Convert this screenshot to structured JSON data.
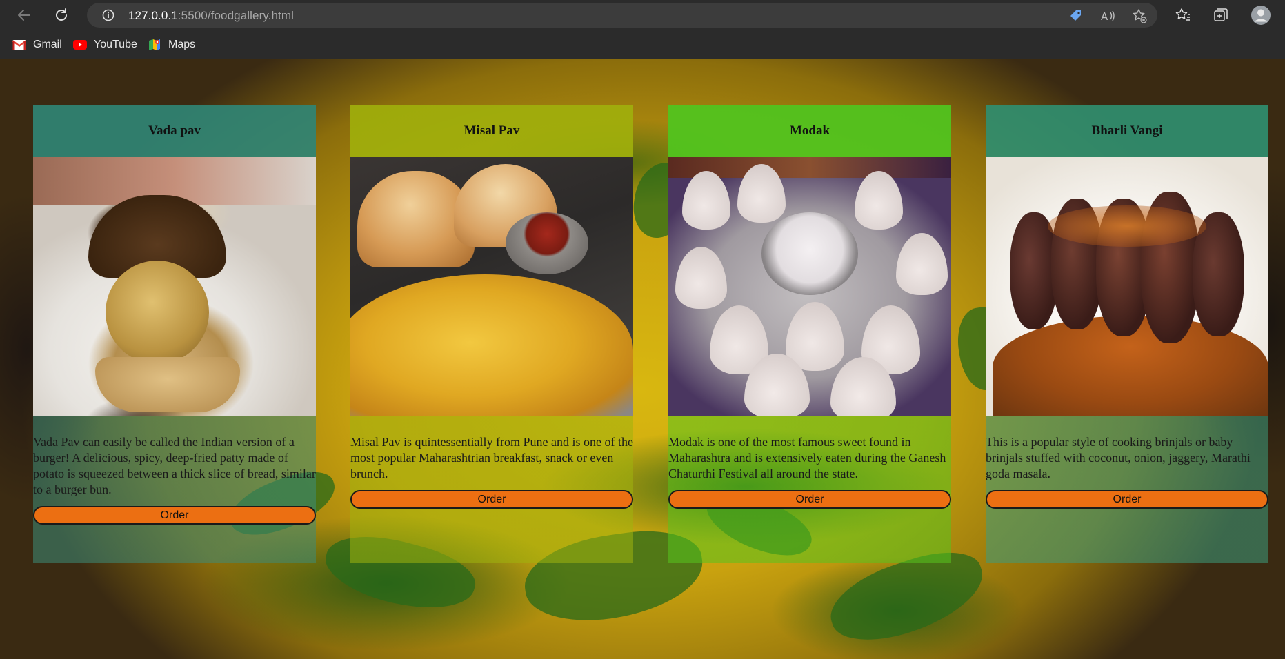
{
  "browser": {
    "url_host": "127.0.0.1",
    "url_path": ":5500/foodgallery.html",
    "bookmarks": [
      {
        "label": "Gmail",
        "icon": "gmail-icon"
      },
      {
        "label": "YouTube",
        "icon": "youtube-icon"
      },
      {
        "label": "Maps",
        "icon": "maps-icon"
      }
    ]
  },
  "cards": [
    {
      "title": "Vada pav",
      "image": "vada-pav-photo",
      "description": "Vada Pav can easily be called the Indian version of a burger! A delicious, spicy, deep-fried patty made of potato is squeezed between a thick slice of bread, similar to a burger bun.",
      "button": "Order",
      "tint": "#3c8c78"
    },
    {
      "title": "Misal Pav",
      "image": "misal-pav-photo",
      "description": "Misal Pav is quintessentially from Pune and is one of the most popular Maharashtrian breakfast, snack or even brunch.",
      "button": "Order",
      "tint": "#9fb30e"
    },
    {
      "title": "Modak",
      "image": "modak-photo",
      "description": "Modak is one of the most famous sweet found in Maharashtra and is extensively eaten during the Ganesh Chaturthi Festival all around the state.",
      "button": "Order",
      "tint": "#56c41e"
    },
    {
      "title": "Bharli Vangi",
      "image": "bharli-vangi-photo",
      "description": "This is a popular style of cooking brinjals or baby brinjals stuffed with coconut, onion, jaggery, Marathi goda masala.",
      "button": "Order",
      "tint": "#3c9c7c"
    }
  ]
}
